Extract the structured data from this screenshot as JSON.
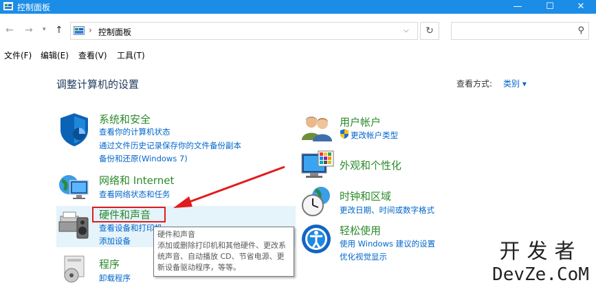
{
  "window": {
    "title": "控制面板",
    "minimize": "—",
    "maximize": "☐",
    "close": "✕"
  },
  "address_bar": {
    "separator": "›",
    "breadcrumb": "控制面板",
    "search_placeholder": ""
  },
  "menu": {
    "items": [
      "文件(F)",
      "编辑(E)",
      "查看(V)",
      "工具(T)"
    ]
  },
  "content": {
    "heading": "调整计算机的设置",
    "view_by_label": "查看方式:",
    "view_by_value": "类别 ▾"
  },
  "categories": {
    "system_security": {
      "title": "系统和安全",
      "links": [
        "查看你的计算机状态",
        "通过文件历史记录保存你的文件备份副本",
        "备份和还原(Windows 7)"
      ]
    },
    "network": {
      "title": "网络和 Internet",
      "links": [
        "查看网络状态和任务"
      ]
    },
    "hardware_sound": {
      "title": "硬件和声音",
      "links": [
        "查看设备和打印机",
        "添加设备"
      ]
    },
    "programs": {
      "title": "程序",
      "links": [
        "卸载程序"
      ]
    },
    "user_accounts": {
      "title": "用户帐户",
      "links": [
        "更改帐户类型"
      ]
    },
    "appearance": {
      "title": "外观和个性化",
      "links": []
    },
    "clock_region": {
      "title": "时钟和区域",
      "links": [
        "更改日期、时间或数字格式"
      ]
    },
    "ease_access": {
      "title": "轻松使用",
      "links": [
        "使用 Windows 建议的设置",
        "优化视觉显示"
      ]
    }
  },
  "tooltip": {
    "title": "硬件和声音",
    "body": "添加或删除打印机和其他硬件、更改系统声音、自动播放 CD、节省电源、更新设备驱动程序，等等。"
  },
  "watermark": {
    "line1": "开发者",
    "line2": "DevZe.CoM"
  },
  "colors": {
    "titlebar": "#1c8de6",
    "category_title": "#2a8a2a",
    "link": "#0066cc",
    "highlight": "#e5f3fb",
    "annotation_red": "#e21b1b"
  }
}
